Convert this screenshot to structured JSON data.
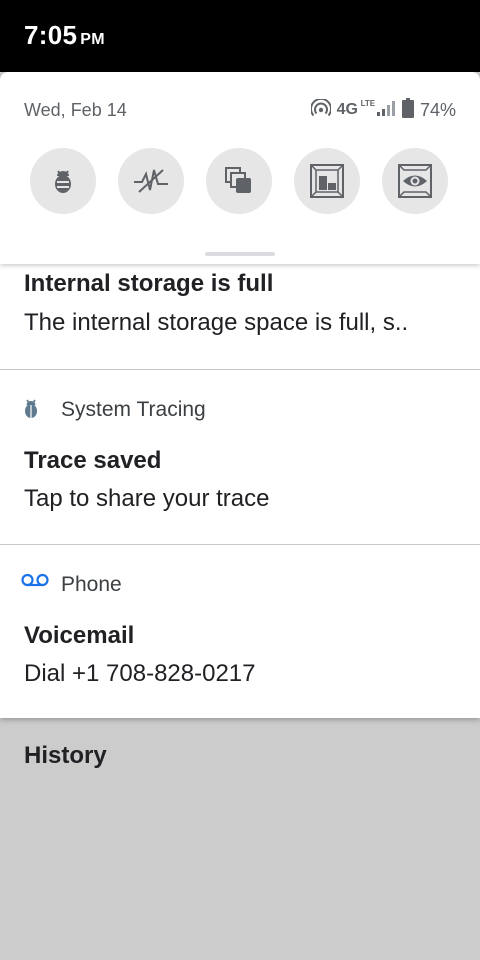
{
  "status_bar": {
    "time": "7:05",
    "ampm": "PM"
  },
  "quick_settings": {
    "date": "Wed, Feb 14",
    "network": "4G",
    "network_sub": "LTE",
    "battery": "74%",
    "tiles": [
      {
        "name": "bug-icon"
      },
      {
        "name": "pulse-icon"
      },
      {
        "name": "stack-icon"
      },
      {
        "name": "frame-icon"
      },
      {
        "name": "eye-icon"
      }
    ]
  },
  "notifications": [
    {
      "title": "Internal storage is full",
      "text": "The internal storage space is full, s.."
    },
    {
      "app": "System Tracing",
      "title": "Trace saved",
      "text": "Tap to share your trace"
    },
    {
      "app": "Phone",
      "title": "Voicemail",
      "text": "Dial +1 708-828-0217"
    }
  ],
  "history_label": "History",
  "colors": {
    "voicemail_accent": "#1a73e8",
    "tile_bg": "#e6e6e6"
  }
}
